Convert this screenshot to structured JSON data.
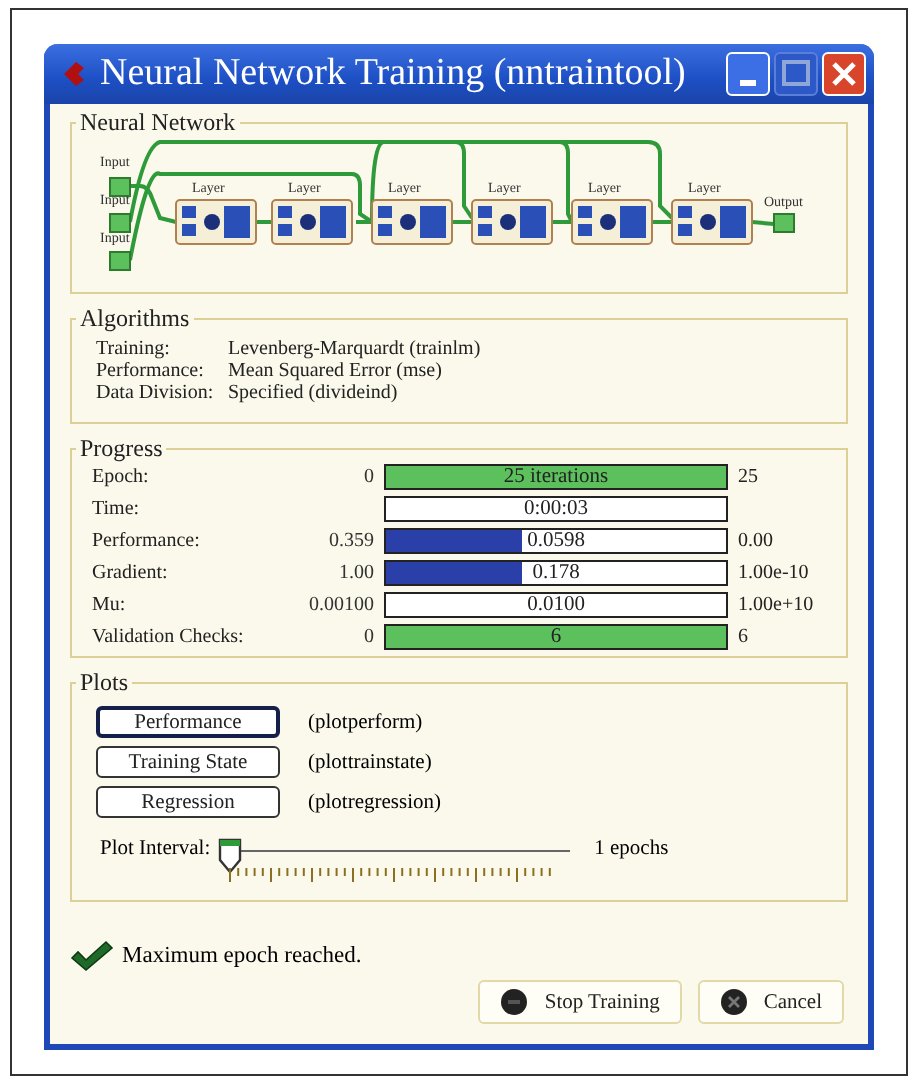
{
  "window": {
    "title": "Neural Network Training (nntraintool)"
  },
  "network": {
    "title": "Neural Network",
    "inputs": [
      "Input",
      "Input",
      "Input"
    ],
    "layers": [
      "Layer",
      "Layer",
      "Layer",
      "Layer",
      "Layer",
      "Layer"
    ],
    "output": "Output"
  },
  "algorithms": {
    "title": "Algorithms",
    "rows": [
      {
        "label": "Training:",
        "value": "Levenberg-Marquardt  (trainlm)"
      },
      {
        "label": "Performance:",
        "value": "Mean Squared Error  (mse)"
      },
      {
        "label": "Data Division:",
        "value": "Specified  (divideind)"
      }
    ]
  },
  "progress": {
    "title": "Progress",
    "rows": [
      {
        "label": "Epoch:",
        "min": "0",
        "value": "25 iterations",
        "max": "25",
        "level": 1,
        "color": "#5cc05c"
      },
      {
        "label": "Time:",
        "value": "0:00:03"
      },
      {
        "label": "Performance:",
        "min": "0.359",
        "value": "0.0598",
        "max": "0.00",
        "level": 0.4,
        "color": "#2a3fa8"
      },
      {
        "label": "Gradient:",
        "min": "1.00",
        "value": "0.178",
        "max": "1.00e-10",
        "level": 0.4,
        "color": "#2a3fa8"
      },
      {
        "label": "Mu:",
        "min": "0.00100",
        "value": "0.0100",
        "max": "1.00e+10"
      },
      {
        "label": "Validation Checks:",
        "min": "0",
        "value": "6",
        "max": "6",
        "level": 1,
        "color": "#5cc05c"
      }
    ]
  },
  "plots": {
    "title": "Plots",
    "buttons": [
      {
        "label": "Performance",
        "fn": "(plotperform)",
        "focused": true
      },
      {
        "label": "Training State",
        "fn": "(plottrainstate)",
        "focused": false
      },
      {
        "label": "Regression",
        "fn": "(plotregression)",
        "focused": false
      }
    ],
    "interval": {
      "label": "Plot Interval:",
      "level": 0,
      "reading": "1 epochs"
    }
  },
  "status": {
    "kind": "success",
    "text": "Maximum epoch reached."
  },
  "buttons": [
    {
      "label": "Stop Training",
      "kind": "stop"
    },
    {
      "label": "Cancel",
      "kind": "cancel"
    }
  ]
}
